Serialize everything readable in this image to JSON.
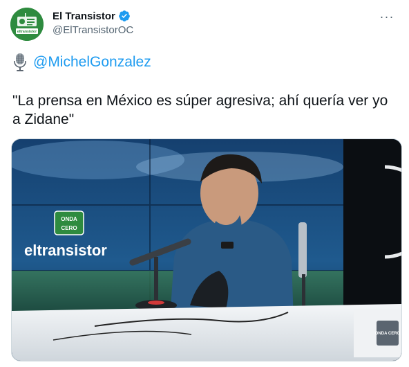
{
  "account": {
    "display_name": "El Transistor",
    "handle": "@ElTransistorOC",
    "verified": true,
    "avatar_text_top": "ONDA CERO",
    "avatar_text_bottom": "eltransistor"
  },
  "tweet": {
    "mention": "@MichelGonzalez",
    "mention_icon": "microphone-icon",
    "text": "\"La prensa en México es súper agresiva; ahí quería ver yo a Zidane\""
  },
  "media": {
    "logo_text": "eltransistor",
    "badge_top": "ONDA",
    "badge_bottom": "CERO",
    "desk_badge": "ONDA CERO"
  },
  "colors": {
    "link": "#1d9bf0",
    "verified": "#1d9bf0",
    "avatar_green": "#2e8b3f",
    "muted": "#536471"
  }
}
